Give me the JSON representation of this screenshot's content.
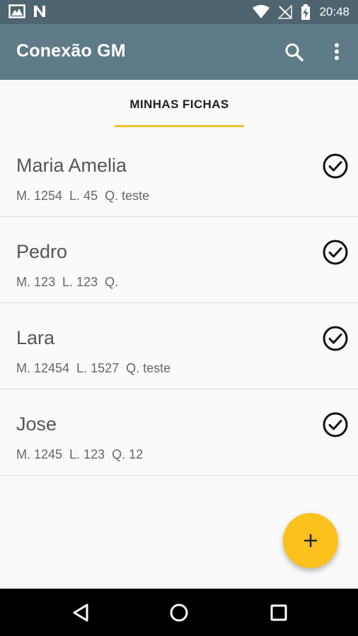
{
  "status_bar": {
    "time": "20:48",
    "icons": [
      "gallery-notification-icon",
      "n-notification-icon",
      "wifi-icon",
      "signal-icon",
      "battery-charging-icon"
    ]
  },
  "app_bar": {
    "title": "Conexão GM",
    "actions": [
      "search-icon",
      "more-vert-icon"
    ]
  },
  "tabs": [
    {
      "label": "MINHAS FICHAS",
      "selected": true
    }
  ],
  "fichas": [
    {
      "name": "Maria Amelia",
      "details": "M. 1254  L. 45  Q. teste",
      "status": "check-circle-icon"
    },
    {
      "name": "Pedro",
      "details": "M. 123  L. 123  Q.",
      "status": "check-circle-icon"
    },
    {
      "name": "Lara",
      "details": "M. 12454  L. 1527  Q. teste",
      "status": "check-circle-icon"
    },
    {
      "name": "Jose",
      "details": "M. 1245  L. 123  Q. 12",
      "status": "check-circle-icon"
    }
  ],
  "fab": {
    "icon": "plus-icon",
    "color": "#fbc11c"
  },
  "nav_bar": {
    "buttons": [
      "back-icon",
      "home-icon",
      "recents-icon"
    ]
  },
  "colors": {
    "status_bar": "#4e6570",
    "app_bar": "#5e7b87",
    "tab_indicator": "#f5c02c",
    "fab": "#fbc11c"
  }
}
